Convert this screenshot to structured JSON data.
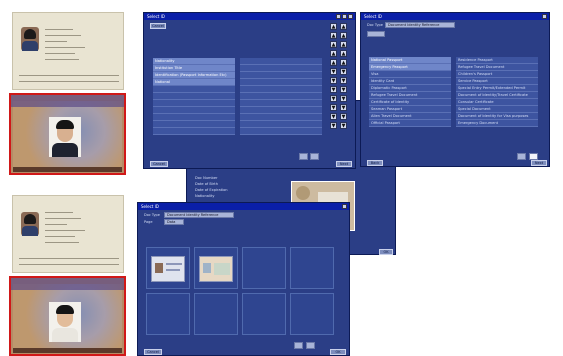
{
  "passport_top": {
    "alt": "passport data page"
  },
  "idcard_top": {
    "alt": "national id card"
  },
  "passport_bottom": {
    "alt": "passport data page"
  },
  "idcard_bottom": {
    "alt": "national id card"
  },
  "win_list": {
    "title": "Select ID",
    "top_button": "Cancel",
    "left_items": [
      "Nationality",
      "Institution Title",
      "Identification (Passport Information Etc)",
      "National",
      "",
      "",
      "",
      "",
      "",
      "",
      ""
    ],
    "right_items": [
      "",
      "",
      "",
      "",
      "",
      "",
      "",
      "",
      "",
      "",
      ""
    ],
    "bottom_left_button": "Cancel",
    "bottom_right_button": "Next",
    "arrow_up": "▲",
    "arrow_down": "▼"
  },
  "win_type": {
    "title": "Select ID",
    "field_label": "Doc Type",
    "field_value": "Document Identity Reference",
    "left_items": [
      "National Passport",
      "Emergency Passport",
      "Visa",
      "Identity Card",
      "Diplomatic Passport",
      "Refugee Travel Document",
      "Certificate of Identity",
      "Seaman Passport",
      "Alien Travel Document",
      "Official Passport"
    ],
    "right_items": [
      "Residence Passport",
      "Refugee Travel Document",
      "Children's Passport",
      "Service Passport",
      "Special Entry Permit/Extended Permit",
      "Document of Identity/Travel Certificate",
      "Consular Certificate",
      "Special Document",
      "Document of Identity for Visa purposes",
      "Emergency Document"
    ],
    "left_button": "Back",
    "right_button": "Next"
  },
  "win_detail": {
    "rows": [
      "Doc Number",
      "Date of Birth",
      "Date of Expiration",
      "Nationality"
    ],
    "values": [
      "",
      "",
      "",
      ""
    ],
    "button": "OK"
  },
  "win_thumbs": {
    "title": "Select ID",
    "field1_label": "Doc Type",
    "field1_value": "Document Identity Reference",
    "field2_label": "Page",
    "field2_value": "Data",
    "left_button": "Cancel",
    "right_button": "OK"
  },
  "colors": {
    "window_bg": "#2b3e86",
    "titlebar": "#0a1fa8",
    "highlight": "#d01818"
  }
}
